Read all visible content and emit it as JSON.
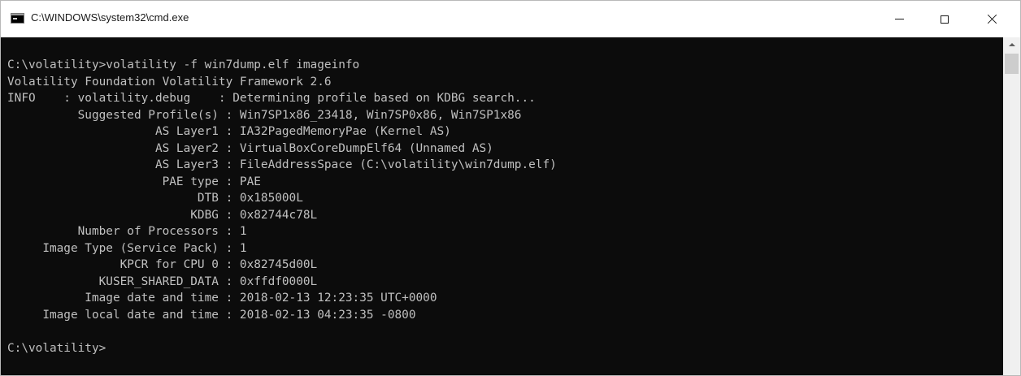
{
  "window": {
    "title": "C:\\WINDOWS\\system32\\cmd.exe",
    "icon": "console-app-icon",
    "controls": {
      "minimize": "minimize-icon",
      "maximize": "maximize-icon",
      "close": "close-icon"
    }
  },
  "console": {
    "background": "#0c0c0c",
    "foreground": "#c0c0c0",
    "lines": [
      "C:\\volatility>volatility -f win7dump.elf imageinfo",
      "Volatility Foundation Volatility Framework 2.6",
      "INFO    : volatility.debug    : Determining profile based on KDBG search...",
      "          Suggested Profile(s) : Win7SP1x86_23418, Win7SP0x86, Win7SP1x86",
      "                     AS Layer1 : IA32PagedMemoryPae (Kernel AS)",
      "                     AS Layer2 : VirtualBoxCoreDumpElf64 (Unnamed AS)",
      "                     AS Layer3 : FileAddressSpace (C:\\volatility\\win7dump.elf)",
      "                      PAE type : PAE",
      "                           DTB : 0x185000L",
      "                          KDBG : 0x82744c78L",
      "          Number of Processors : 1",
      "     Image Type (Service Pack) : 1",
      "                KPCR for CPU 0 : 0x82745d00L",
      "             KUSER_SHARED_DATA : 0xffdf0000L",
      "           Image date and time : 2018-02-13 12:23:35 UTC+0000",
      "     Image local date and time : 2018-02-13 04:23:35 -0800",
      "",
      "C:\\volatility>"
    ]
  },
  "scrollbar": {
    "up_arrow": "chevron-up-icon"
  }
}
